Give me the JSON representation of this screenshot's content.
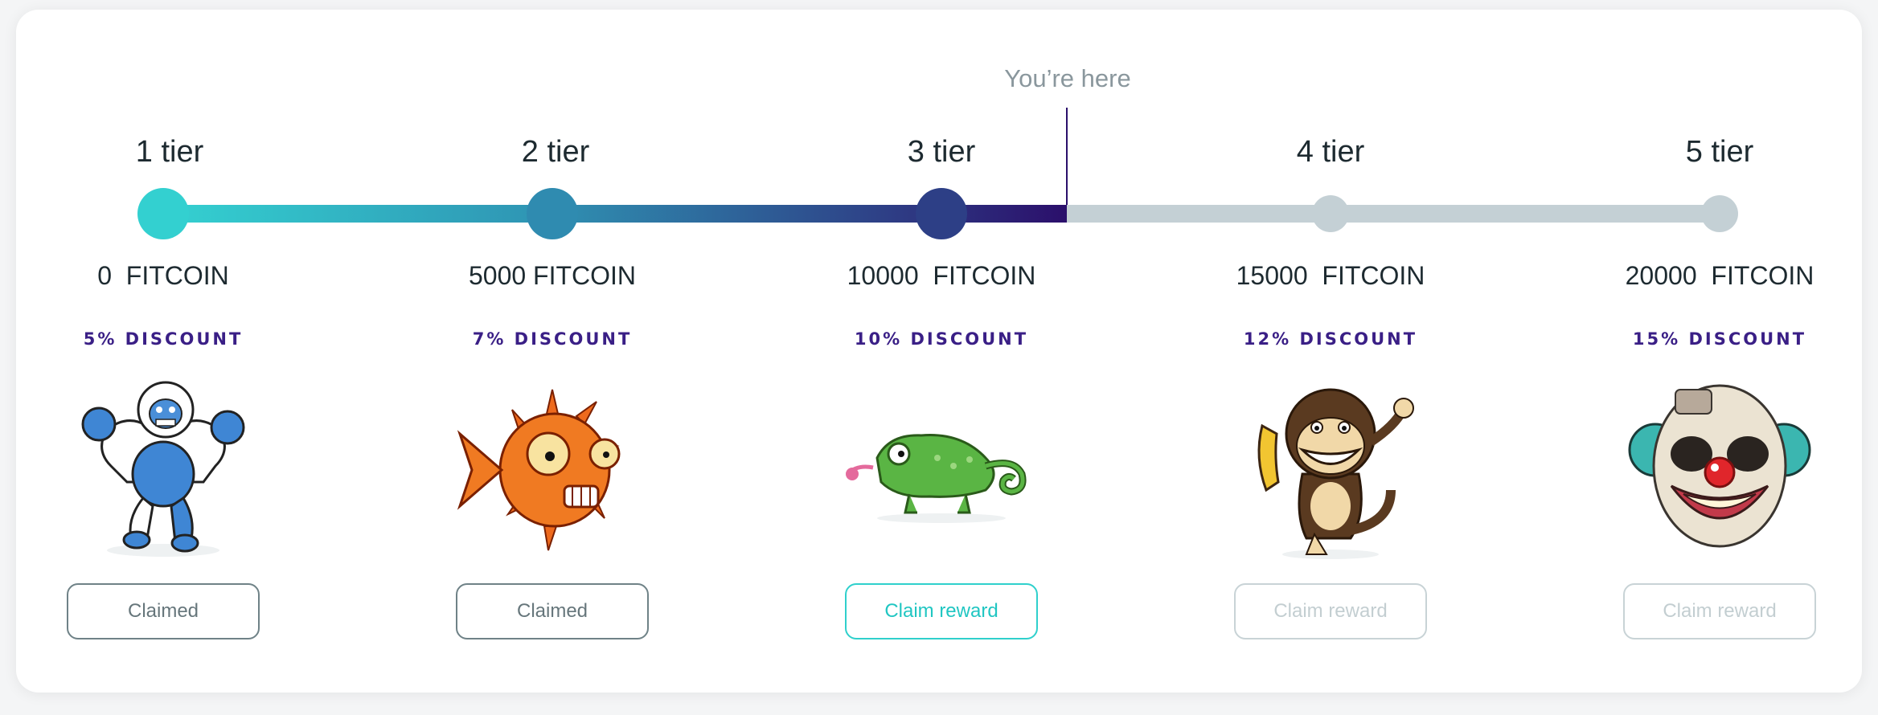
{
  "marker": {
    "label": "You’re here"
  },
  "progress": {
    "current_tier_index": 2,
    "fill_fraction": 0.58
  },
  "colors": {
    "tier1": "#33d0d0",
    "tier2": "#2f8bb0",
    "tier3": "#2d3f86",
    "locked": "#c4d0d5",
    "discount_text": "#3a1f86",
    "active_button": "#2fd0cc"
  },
  "tiers": [
    {
      "title": "1 tier",
      "coins": "0  FITCOIN",
      "discount": "5% DISCOUNT",
      "mascot": "yeti-icon",
      "button": "Claimed",
      "state": "claimed"
    },
    {
      "title": "2 tier",
      "coins": "5000 FITCOIN",
      "discount": "7% DISCOUNT",
      "mascot": "pufferfish-icon",
      "button": "Claimed",
      "state": "claimed"
    },
    {
      "title": "3 tier",
      "coins": "10000  FITCOIN",
      "discount": "10% DISCOUNT",
      "mascot": "chameleon-icon",
      "button": "Claim reward",
      "state": "available"
    },
    {
      "title": "4 tier",
      "coins": "15000  FITCOIN",
      "discount": "12% DISCOUNT",
      "mascot": "monkey-icon",
      "button": "Claim reward",
      "state": "locked"
    },
    {
      "title": "5 tier",
      "coins": "20000  FITCOIN",
      "discount": "15% DISCOUNT",
      "mascot": "clown-icon",
      "button": "Claim reward",
      "state": "locked"
    }
  ]
}
